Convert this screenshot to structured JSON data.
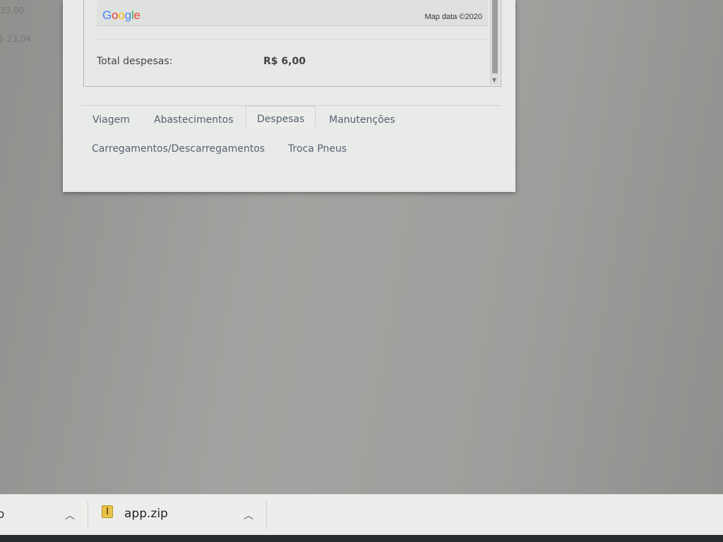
{
  "background": {
    "partial_values": [
      "33,00",
      "$ 23,04"
    ]
  },
  "map": {
    "logo_letters": [
      "G",
      "o",
      "o",
      "g",
      "l",
      "e"
    ],
    "attribution": "Map data ©2020"
  },
  "summary": {
    "total_label": "Total despesas:",
    "total_value": "R$ 6,00"
  },
  "tabs": [
    {
      "label": "Viagem",
      "active": false
    },
    {
      "label": "Abastecimentos",
      "active": false
    },
    {
      "label": "Despesas",
      "active": true
    },
    {
      "label": "Manutenções",
      "active": false
    },
    {
      "label": "Carregamentos/Descarregamentos",
      "active": false
    },
    {
      "label": "Troca Pneus",
      "active": false
    }
  ],
  "taskbar": {
    "left_fragment": "o",
    "download_name": "app.zip"
  },
  "colors": {
    "tab_text": "#556171",
    "google_blue": "#4285f4",
    "google_red": "#ea4335",
    "google_yellow": "#fbbc05",
    "google_green": "#34a853"
  }
}
